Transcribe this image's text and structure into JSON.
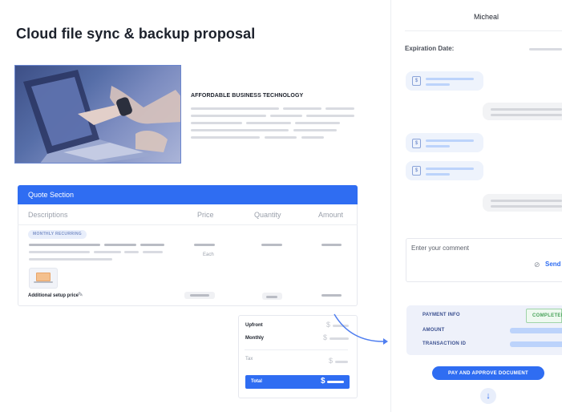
{
  "document": {
    "title": "Cloud file sync & backup proposal",
    "hero_heading": "AFFORDABLE BUSINESS TECHNOLOGY"
  },
  "quote": {
    "section_title": "Quote Section",
    "columns": [
      "Descriptions",
      "Price",
      "Quantity",
      "Amount"
    ],
    "recurring_badge": "MONTHLY RECURRING",
    "price_unit": "Each",
    "setup_label": "Additional setup price"
  },
  "summary": {
    "upfront_label": "Upfront",
    "monthly_label": "Monthly",
    "tax_label": "Tax",
    "total_label": "Total",
    "currency": "$"
  },
  "panel": {
    "user_name": "Micheal",
    "expiration_label": "Expiration Date:",
    "comment_placeholder": "Enter your comment",
    "send_label": "Send",
    "payment": {
      "info_label": "PAYMENT INFO",
      "status": "COMPLETED",
      "amount_label": "AMOUNT",
      "transaction_label": "TRANSACTION ID"
    },
    "approve_button": "PAY AND APPROVE DOCUMENT"
  },
  "icons": {
    "attachment": "paperclip-icon",
    "edit": "pencil-icon",
    "document": "document-icon",
    "scroll_down": "arrow-down-icon"
  },
  "colors": {
    "accent": "#2f6df2",
    "success": "#48a35a"
  }
}
